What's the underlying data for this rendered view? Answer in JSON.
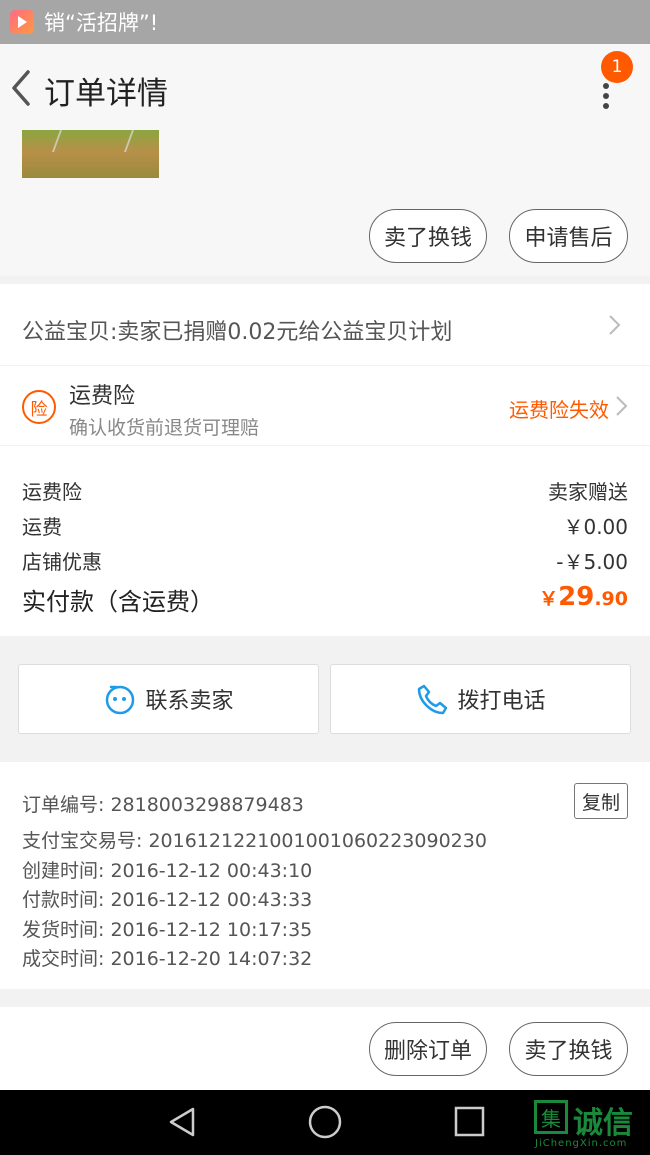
{
  "status_bar": {
    "app_name": "销“活招牌”!"
  },
  "header": {
    "title": "订单详情",
    "notification_count": "1"
  },
  "product": {
    "actions": {
      "sell_label": "卖了换钱",
      "after_sale_label": "申请售后"
    }
  },
  "charity": {
    "text": "公益宝贝:卖家已捐赠0.02元给公益宝贝计划"
  },
  "insurance": {
    "badge": "险",
    "title": "运费险",
    "subtitle": "确认收货前退货可理赔",
    "status": "运费险失效"
  },
  "fees": [
    {
      "label": "运费险",
      "value": "卖家赠送"
    },
    {
      "label": "运费",
      "value": "￥0.00"
    },
    {
      "label": "店铺优惠",
      "value": "-￥5.00"
    }
  ],
  "total": {
    "label": "实付款（含运费）",
    "currency": "￥",
    "integer": "29",
    "decimal": ".90"
  },
  "contact": {
    "seller_label": "联系卖家",
    "call_label": "拨打电话"
  },
  "order_info": {
    "order_no_label": "订单编号:",
    "order_no": "2818003298879483",
    "copy_label": "复制",
    "lines": [
      {
        "label": "支付宝交易号:",
        "value": "2016121221001001060223090230"
      },
      {
        "label": "创建时间:",
        "value": "2016-12-12 00:43:10"
      },
      {
        "label": "付款时间:",
        "value": "2016-12-12 00:43:33"
      },
      {
        "label": "发货时间:",
        "value": "2016-12-12 10:17:35"
      },
      {
        "label": "成交时间:",
        "value": "2016-12-20 14:07:32"
      }
    ]
  },
  "bottom_actions": {
    "delete_label": "删除订单",
    "sell_label": "卖了换钱"
  },
  "watermark": {
    "logo_char": "集",
    "brand": "诚信",
    "url": "JiChengXin.com"
  },
  "colors": {
    "accent": "#ff5a00",
    "status_bar": "#a6a6a6"
  }
}
